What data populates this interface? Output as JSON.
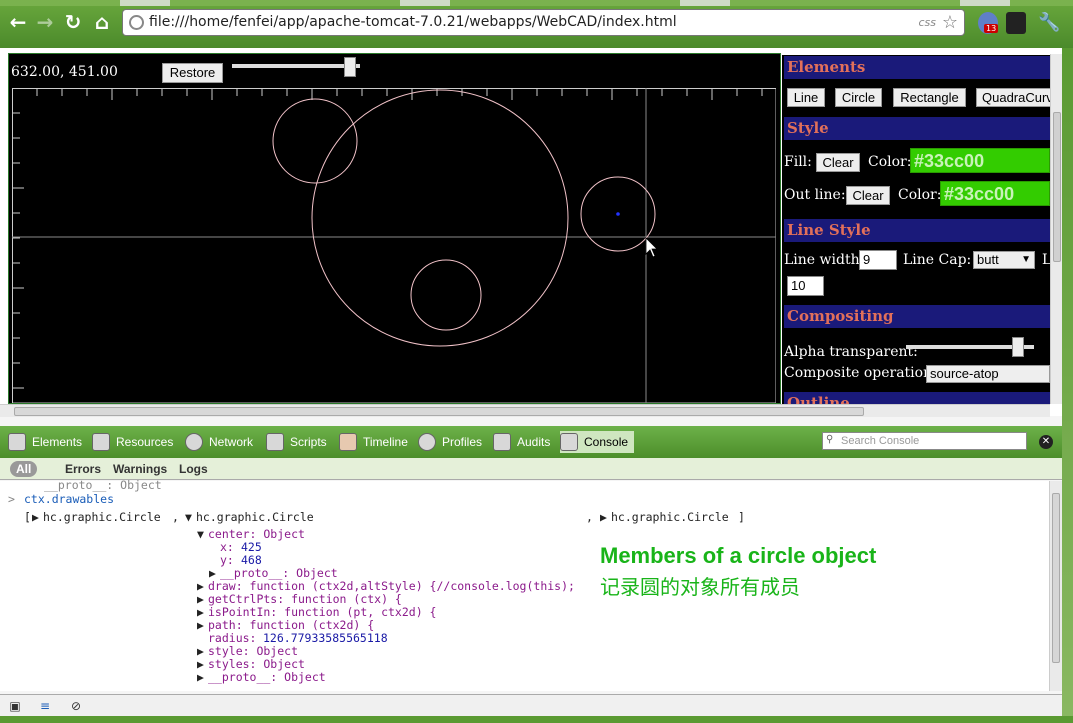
{
  "browser": {
    "url": "file:///home/fenfei/app/apache-tomcat-7.0.21/webapps/WebCAD/index.html",
    "css_badge": "css",
    "ext_badge": "13"
  },
  "cad": {
    "coords": "632.00, 451.00",
    "restore_label": "Restore"
  },
  "panel": {
    "elements_title": "Elements",
    "element_buttons": [
      "Line",
      "Circle",
      "Rectangle",
      "QuadraCurv"
    ],
    "style_title": "Style",
    "fill_label": "Fill:",
    "outline_label": "Out line:",
    "clear_label": "Clear",
    "color_label": "Color:",
    "fill_color": "#33cc00",
    "outline_color": "#33cc00",
    "line_style_title": "Line Style",
    "line_width_label": "Line width:",
    "line_width_value": "9",
    "line_cap_label": "Line Cap:",
    "line_cap_value": "butt",
    "line_extra_label": "L",
    "miter_value": "10",
    "compositing_title": "Compositing",
    "alpha_label": "Alpha transparent:",
    "composite_label": "Composite operation:",
    "composite_value": "source-atop",
    "outline_title": "Outline"
  },
  "devtools": {
    "tabs": [
      "Elements",
      "Resources",
      "Network",
      "Scripts",
      "Timeline",
      "Profiles",
      "Audits",
      "Console"
    ],
    "search_placeholder": "Search Console",
    "filters": [
      "All",
      "Errors",
      "Warnings",
      "Logs"
    ]
  },
  "console": {
    "proto_top": "__proto__: Object",
    "command": "ctx.drawables",
    "item1": "hc.graphic.Circle",
    "item2": "hc.graphic.Circle",
    "item3": "hc.graphic.Circle",
    "center": "center: Object",
    "x_key": "x:",
    "x_val": "425",
    "y_key": "y:",
    "y_val": "468",
    "proto_inner": "__proto__: Object",
    "draw": "draw: function (ctx2d,altStyle) {//console.log(this);",
    "getCtrlPts": "getCtrlPts: function (ctx) {",
    "isPointIn": "isPointIn: function (pt, ctx2d) {",
    "path": "path: function (ctx2d) {",
    "radius_key": "radius:",
    "radius_val": "126.77933585565118",
    "style": "style: Object",
    "styles": "styles: Object",
    "proto_last": "__proto__: Object"
  },
  "annotation": {
    "english": "Members of a circle object",
    "chinese": "记录圆的对象所有成员"
  }
}
